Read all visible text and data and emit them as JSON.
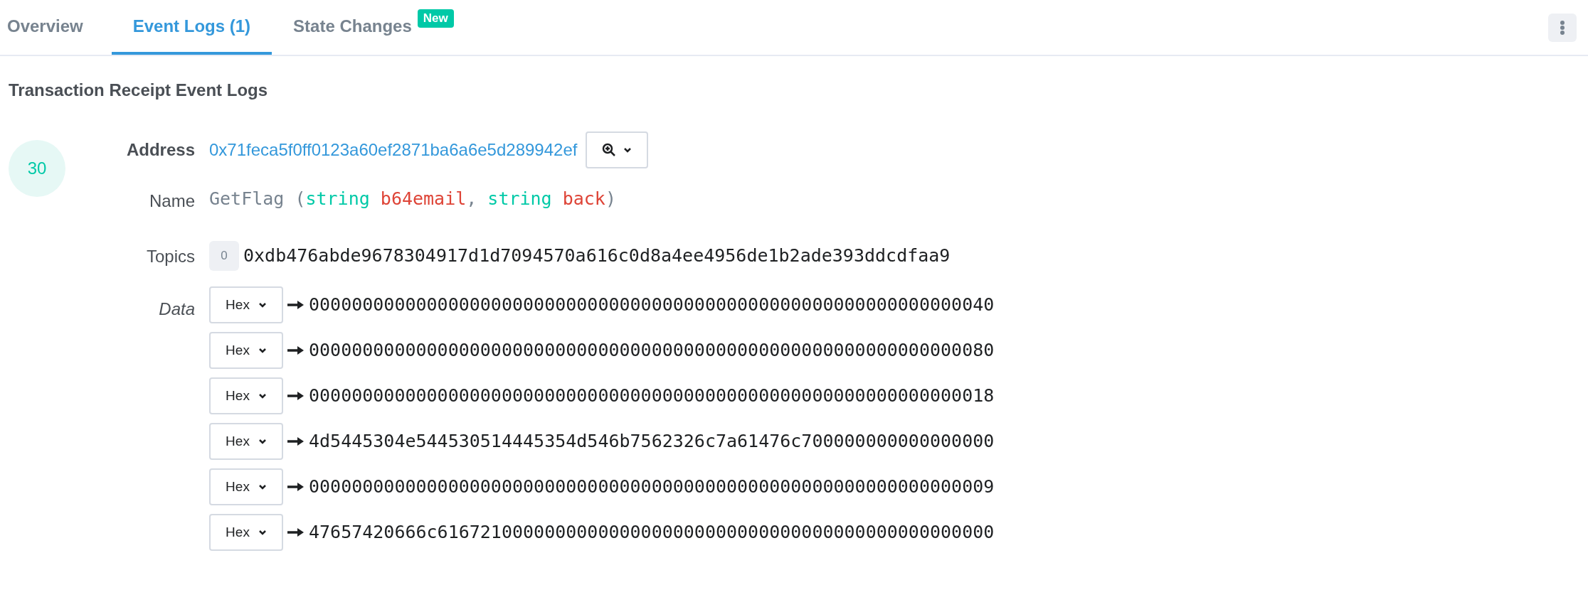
{
  "tabs": [
    {
      "label": "Overview",
      "selected": false
    },
    {
      "label": "Event Logs (1)",
      "selected": true
    },
    {
      "label": "State Changes",
      "selected": false,
      "badge": "New"
    }
  ],
  "heading": "Transaction Receipt Event Logs",
  "log": {
    "index": "30",
    "address": {
      "label": "Address",
      "value": "0x71feca5f0ff0123a60ef2871ba6a6e5d289942ef"
    },
    "name": {
      "label": "Name",
      "parts": [
        {
          "kind": "plain",
          "text": "GetFlag ("
        },
        {
          "kind": "type",
          "text": "string "
        },
        {
          "kind": "param",
          "text": "b64email"
        },
        {
          "kind": "plain",
          "text": ", "
        },
        {
          "kind": "type",
          "text": "string "
        },
        {
          "kind": "param",
          "text": "back"
        },
        {
          "kind": "plain",
          "text": ")"
        }
      ]
    },
    "topics": {
      "label": "Topics",
      "items": [
        {
          "index": "0",
          "value": "0xdb476abde9678304917d1d7094570a616c0d8a4ee4956de1b2ade393ddcdfaa9"
        }
      ]
    },
    "data": {
      "label": "Data",
      "rows": [
        {
          "format": "Hex",
          "value": "0000000000000000000000000000000000000000000000000000000000000040"
        },
        {
          "format": "Hex",
          "value": "0000000000000000000000000000000000000000000000000000000000000080"
        },
        {
          "format": "Hex",
          "value": "0000000000000000000000000000000000000000000000000000000000000018"
        },
        {
          "format": "Hex",
          "value": "4d5445304e544530514445354d546b7562326c7a61476c700000000000000000"
        },
        {
          "format": "Hex",
          "value": "0000000000000000000000000000000000000000000000000000000000000009"
        },
        {
          "format": "Hex",
          "value": "47657420666c6167210000000000000000000000000000000000000000000000"
        }
      ]
    }
  }
}
